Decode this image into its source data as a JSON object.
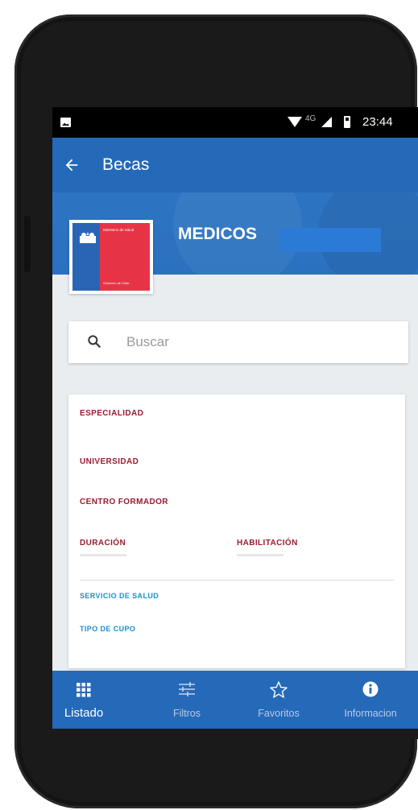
{
  "status_bar": {
    "network": "4G",
    "time": "23:44"
  },
  "app_bar": {
    "back_icon": "arrow-back-icon",
    "title": "Becas"
  },
  "banner": {
    "title": "MEDICOS",
    "logo": {
      "ministry": "Ministerio de Salud",
      "government": "Gobierno de Chile"
    }
  },
  "search": {
    "placeholder": "Buscar",
    "value": ""
  },
  "details": {
    "especialidad": "ESPECIALIDAD",
    "universidad": "UNIVERSIDAD",
    "centro_formador": "CENTRO FORMADOR",
    "duracion": "DURACIÓN",
    "habilitacion": "HABILITACIÓN",
    "servicio_salud": "SERVICIO DE SALUD",
    "tipo_cupo": "TIPO DE CUPO"
  },
  "bottom_nav": {
    "items": [
      {
        "label": "Listado",
        "icon": "grid-icon",
        "active": true
      },
      {
        "label": "Filtros",
        "icon": "sliders-icon",
        "active": false
      },
      {
        "label": "Favoritos",
        "icon": "star-icon",
        "active": false
      },
      {
        "label": "Informacion",
        "icon": "info-icon",
        "active": false
      }
    ]
  },
  "colors": {
    "primary": "#2569b9",
    "label_red": "#9b1b30",
    "label_blue": "#1a8fd0",
    "logo_blue": "#2a65b5",
    "logo_red": "#e63446"
  }
}
